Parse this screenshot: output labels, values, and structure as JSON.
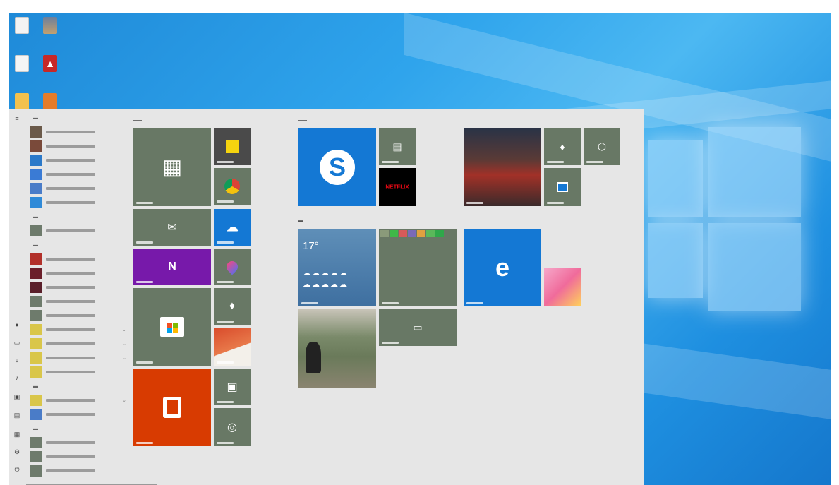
{
  "tiles": {
    "netflix": "NETFLIX",
    "weather_temp": "17°"
  }
}
